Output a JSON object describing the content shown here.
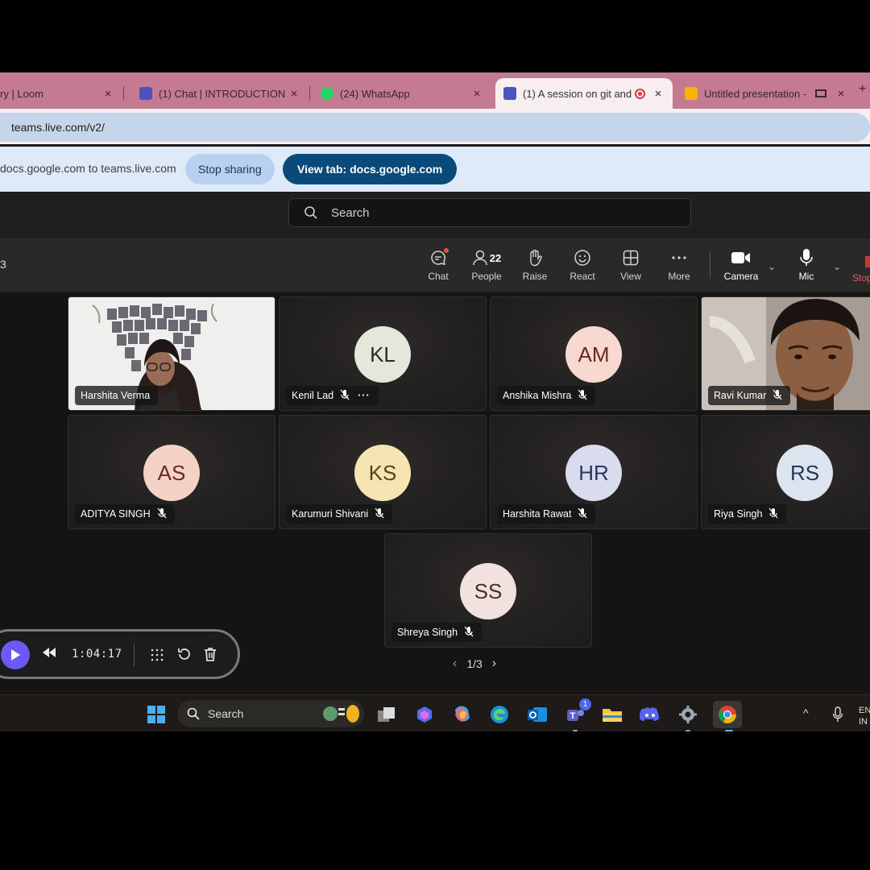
{
  "browser": {
    "tabs": [
      {
        "title": "ry | Loom",
        "active": false
      },
      {
        "title": "(1) Chat | INTRODUCTION",
        "active": false
      },
      {
        "title": "(24) WhatsApp",
        "active": false
      },
      {
        "title": "(1) A session on git and",
        "active": true,
        "recording": true
      },
      {
        "title": "Untitled presentation -",
        "active": false
      }
    ],
    "url": "teams.live.com/v2/",
    "close_glyph": "×",
    "new_tab_glyph": "+"
  },
  "share_bar": {
    "text": "docs.google.com to teams.live.com",
    "stop_label": "Stop sharing",
    "view_tab_label": "View tab: docs.google.com"
  },
  "teams": {
    "search_placeholder": "Search",
    "meeting_time_fragment": "3",
    "toolbar": {
      "chat": "Chat",
      "people": "People",
      "people_count": "22",
      "raise": "Raise",
      "react": "React",
      "view": "View",
      "more": "More",
      "camera": "Camera",
      "mic": "Mic",
      "stop": "Stop"
    },
    "participants": [
      {
        "name": "Harshita Verma",
        "initials": "",
        "video": true,
        "avatar_color": "#eeeeec"
      },
      {
        "name": "Kenil Lad",
        "initials": "KL",
        "video": false,
        "avatar_color": "#e4e8dc",
        "text_color": "#2a2a2a",
        "more": "···"
      },
      {
        "name": "Anshika Mishra",
        "initials": "AM",
        "video": false,
        "avatar_color": "#f8d9cf",
        "text_color": "#6a2a20"
      },
      {
        "name": "Ravi Kumar",
        "initials": "",
        "video": true,
        "avatar_color": "#9a8f86"
      },
      {
        "name": "ADITYA SINGH",
        "initials": "AS",
        "video": false,
        "avatar_color": "#f5d2c6",
        "text_color": "#6a2a20"
      },
      {
        "name": "Karumuri Shivani",
        "initials": "KS",
        "video": false,
        "avatar_color": "#f7e4b3",
        "text_color": "#5a4510"
      },
      {
        "name": "Harshita Rawat",
        "initials": "HR",
        "video": false,
        "avatar_color": "#d9dcef",
        "text_color": "#2d3560"
      },
      {
        "name": "Riya Singh",
        "initials": "RS",
        "video": false,
        "avatar_color": "#dce4ef",
        "text_color": "#243a5a"
      },
      {
        "name": "Shreya Singh",
        "initials": "SS",
        "video": false,
        "avatar_color": "#f1e2df",
        "text_color": "#4a2f2a"
      }
    ],
    "pager": {
      "label": "1/3",
      "prev": "‹",
      "next": "›"
    }
  },
  "loom": {
    "time": "1:04:17"
  },
  "taskbar": {
    "search_label": "Search",
    "teams_badge": "1",
    "lang": "EN",
    "lang2": "IN",
    "tray_arrow": "^"
  }
}
